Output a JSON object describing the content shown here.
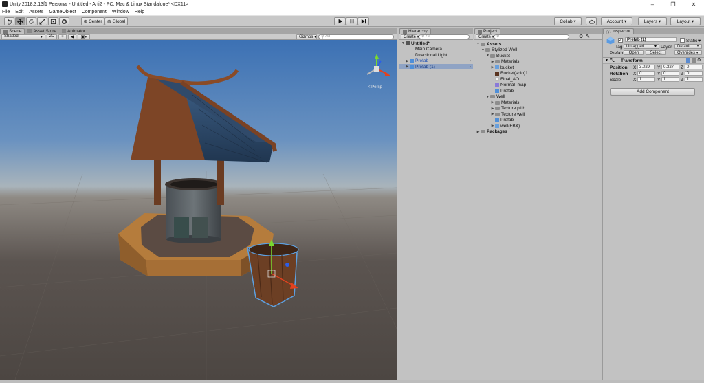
{
  "window": {
    "title": "Unity 2018.3.13f1 Personal - Untitled - Arti2 - PC, Mac & Linux Standalone* <DX11>",
    "minimize": "–",
    "maximize": "❐",
    "close": "✕"
  },
  "menu": [
    "File",
    "Edit",
    "Assets",
    "GameObject",
    "Component",
    "Window",
    "Help"
  ],
  "toolbar": {
    "pivot": "Center",
    "space": "Global",
    "collab": "Collab ▾",
    "account": "Account ▾",
    "layers": "Layers ▾",
    "layout": "Layout ▾"
  },
  "scene": {
    "tabs": [
      "Scene",
      "Asset Store",
      "Animator"
    ],
    "shading": "Shaded",
    "mode_2d": "2D",
    "gizmos": "Gizmos ▾",
    "search_placeholder": "All",
    "persp": "< Persp"
  },
  "hierarchy": {
    "tab": "Hierarchy",
    "create": "Create ▾",
    "search_placeholder": "All",
    "items": [
      {
        "label": "Untitled*",
        "depth": 0,
        "arrow": "▼",
        "type": "scene"
      },
      {
        "label": "Main Camera",
        "depth": 1,
        "arrow": "",
        "type": "go"
      },
      {
        "label": "Directional Light",
        "depth": 1,
        "arrow": "",
        "type": "go"
      },
      {
        "label": "Prefab",
        "depth": 1,
        "arrow": "▶",
        "type": "prefab"
      },
      {
        "label": "Prefab (1)",
        "depth": 1,
        "arrow": "▶",
        "type": "prefab",
        "selected": true
      }
    ]
  },
  "project": {
    "tab": "Project",
    "create": "Create ▾",
    "items": [
      {
        "label": "Assets",
        "depth": 0,
        "arrow": "▼",
        "type": "folder",
        "bold": true
      },
      {
        "label": "Stylized Well",
        "depth": 1,
        "arrow": "▼",
        "type": "folder"
      },
      {
        "label": "Bucket",
        "depth": 2,
        "arrow": "▼",
        "type": "folder"
      },
      {
        "label": "Materials",
        "depth": 3,
        "arrow": "▶",
        "type": "folder"
      },
      {
        "label": "bucket",
        "depth": 3,
        "arrow": "▶",
        "type": "model"
      },
      {
        "label": "Bucket(solo)1",
        "depth": 3,
        "arrow": "",
        "type": "tex-brown"
      },
      {
        "label": "Final_AO",
        "depth": 3,
        "arrow": "",
        "type": "tex-white"
      },
      {
        "label": "Normal_map",
        "depth": 3,
        "arrow": "",
        "type": "tex-normal"
      },
      {
        "label": "Prefab",
        "depth": 3,
        "arrow": "",
        "type": "prefab"
      },
      {
        "label": "Well",
        "depth": 2,
        "arrow": "▼",
        "type": "folder"
      },
      {
        "label": "Materials",
        "depth": 3,
        "arrow": "▶",
        "type": "folder"
      },
      {
        "label": "Texture plith",
        "depth": 3,
        "arrow": "▶",
        "type": "folder"
      },
      {
        "label": "Texture well",
        "depth": 3,
        "arrow": "▶",
        "type": "folder"
      },
      {
        "label": "Prefab",
        "depth": 3,
        "arrow": "",
        "type": "prefab"
      },
      {
        "label": "well(FBX)",
        "depth": 3,
        "arrow": "▶",
        "type": "model"
      },
      {
        "label": "Packages",
        "depth": 0,
        "arrow": "▶",
        "type": "folder",
        "bold": true
      }
    ]
  },
  "inspector": {
    "tab": "Inspector",
    "name": "Prefab (1)",
    "static": "Static ▾",
    "tag_label": "Tag",
    "tag": "Untagged",
    "layer_label": "Layer",
    "layer": "Default",
    "prefab_label": "Prefab",
    "open": "Open",
    "select": "Select",
    "overrides": "Overrides ▾",
    "transform": "Transform",
    "position_label": "Position",
    "rotation_label": "Rotation",
    "scale_label": "Scale",
    "x": "X",
    "y": "Y",
    "z": "Z",
    "position": {
      "x": "3.029",
      "y": "0.327",
      "z": "0"
    },
    "rotation": {
      "x": "0",
      "y": "0",
      "z": "0"
    },
    "scale": {
      "x": "1",
      "y": "1",
      "z": "1"
    },
    "add_component": "Add Component"
  },
  "colors": {
    "selection": "#8fa3c4",
    "prefab_text": "#1d4fb3",
    "panel_bg": "#c2c2c2",
    "sky": "#3c71b4",
    "ground": "#4a4440"
  }
}
